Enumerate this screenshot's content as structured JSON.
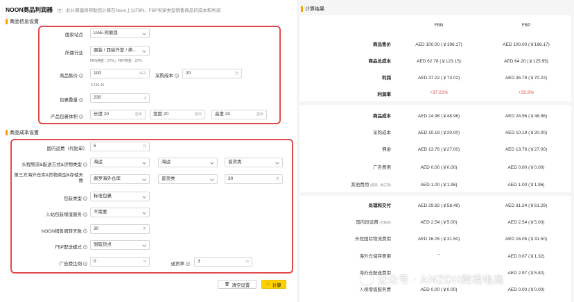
{
  "header": {
    "title": "NOON商品利润器",
    "note": "注：此计算器将帮助您计算在Noon上以FBN、FBP卖家类型销售商品的成本和利润"
  },
  "product_section": {
    "title": "商品信息设置",
    "country_label": "国家站点",
    "country_value": "UAE-阿联酋",
    "industry_label": "所属行业",
    "industry_value": "服装 / 西装外套 / 燕...",
    "commission_note": "FBN佣金：27%；FBP佣金：27%",
    "price_label": "商品售价",
    "price_value": "100",
    "price_unit": "AED",
    "price_cny": "￥196.46",
    "purchase_label": "采购成本",
    "purchase_value": "20",
    "purchase_unit": "元",
    "weight_label": "包裹重量",
    "weight_value": "230",
    "weight_unit": "g",
    "volume_label": "产品包裹体积",
    "length_value": "长度 20",
    "width_value": "宽度 20",
    "height_value": "高度 20",
    "dim_unit": "厘米"
  },
  "cost_section": {
    "title": "商品成本设置",
    "domestic_label": "国内运费（代贴单）",
    "domestic_value": "5",
    "domestic_unit": "元",
    "headhaul_label": "头程物流&配送方式&货物类型",
    "headhaul_mode": "海运",
    "headhaul_method": "海运",
    "headhaul_type": "普货类",
    "overseas_label": "第三方海外仓库&货物类型&存储天数",
    "overseas_warehouse": "佩罗海外仓库",
    "overseas_type": "普货类",
    "storage_days": "30",
    "storage_unit": "天",
    "package_label": "包装类型",
    "package_value": "标准包裹",
    "inbound_label": "入站包装增值服务",
    "inbound_value": "不需要",
    "sales_days_label": "NOON销售周转天数",
    "sales_days_value": "30",
    "sales_days_unit": "天",
    "fbp_label": "FBP配送模式",
    "fbp_value": "到取货点",
    "ad_label": "广告费比例",
    "ad_value": "0",
    "ad_unit": "%",
    "return_label": "退货率",
    "return_value": "3",
    "return_unit": "%"
  },
  "actions": {
    "clear_label": "清空设置",
    "calc_label": "计算"
  },
  "results": {
    "title": "计算结果",
    "col_fbn": "FBN",
    "col_fbp": "FBP",
    "rows": [
      {
        "name": "商品售价",
        "fbn": "AED 100.00 (￥196.17)",
        "fbp": "AED 100.00 (￥196.17)"
      },
      {
        "name": "商品总成本",
        "fbn": "AED 62.78 (￥123.15)",
        "fbp": "AED 64.20 (￥125.95)"
      },
      {
        "name": "利润",
        "fbn": "AED 37.22 (￥73.02)",
        "fbp": "AED 35.79 (￥70.22)"
      },
      {
        "name": "利润率",
        "fbn": "+37.22%",
        "fbp": "+35.8%"
      },
      {
        "name": "商品成本",
        "fbn": "AED 24.96 (￥48.96)",
        "fbp": "AED 24.96 (￥48.96)"
      },
      {
        "name": "采购成本",
        "fbn": "AED 10.19 (￥20.00)",
        "fbp": "AED 10.19 (￥20.00)"
      },
      {
        "name": "佣金",
        "fbn": "AED 13.76 (￥27.00)",
        "fbp": "AED 13.76 (￥27.00)"
      },
      {
        "name": "广告费用",
        "fbn": "AED 0.00 (￥0.00)",
        "fbp": "AED 0.00 (￥0.00)"
      },
      {
        "name": "其他费用",
        "name_sub": "(提现、换汇等)",
        "fbn": "AED 1.00 (￥1.96)",
        "fbp": "AED 1.00 (￥1.96)"
      },
      {
        "name": "处理和交付",
        "fbn": "AED 29.82 (￥58.49)",
        "fbp": "AED 31.24 (￥61.29)"
      },
      {
        "name": "国内段运费",
        "name_sub": "(代贴单)",
        "fbn": "AED 2.54 (￥5.00)",
        "fbp": "AED 2.54 (￥5.00)"
      },
      {
        "name": "头程国际物流费用",
        "fbn": "AED 16.05 (￥31.50)",
        "fbp": "AED 16.05 (￥31.50)"
      },
      {
        "name": "海外仓储存费用",
        "fbn": "-",
        "fbp": "AED 0.67 (￥1.32)"
      },
      {
        "name": "海外仓配送费用",
        "fbn": "",
        "fbp": "AED 2.97 (￥5.82)"
      },
      {
        "name": "入境增值服务费",
        "fbn": "AED 0.00 (￥0.00)",
        "fbp": "AED 0.00 (￥0.00)"
      }
    ]
  },
  "watermark": "公众号 · AMZDH跨境电商"
}
